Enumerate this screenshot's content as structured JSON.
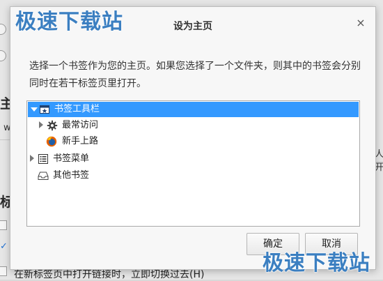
{
  "watermark": {
    "text": "极速下载站"
  },
  "background": {
    "heading_1": "主页",
    "heading_2": "标签",
    "frag_w": "w",
    "frag_right": "人开",
    "bottom_text": "在新标签页中打开链接时，立即切换过去(H)"
  },
  "dialog": {
    "title": "设为主页",
    "close_symbol": "×",
    "description": "选择一个书签作为您的主页。如果您选择了一个文件夹，则其中的书签会分别同时在若干标签页里打开。",
    "tree": {
      "items": [
        {
          "label": "书签工具栏",
          "icon": "bookmarks-toolbar-icon",
          "expanded": true,
          "selected": true
        },
        {
          "label": "最常访问",
          "icon": "gear-icon",
          "expanded": false,
          "selected": false
        },
        {
          "label": "新手上路",
          "icon": "firefox-icon",
          "expanded": false,
          "selected": false
        },
        {
          "label": "书签菜单",
          "icon": "bookmarks-menu-icon",
          "expanded": false,
          "selected": false
        },
        {
          "label": "其他书签",
          "icon": "inbox-folder-icon",
          "expanded": false,
          "selected": false
        }
      ]
    },
    "buttons": {
      "ok": "确定",
      "cancel": "取消"
    }
  },
  "colors": {
    "selection": "#3399ff",
    "watermark": "#3b7fc1"
  }
}
